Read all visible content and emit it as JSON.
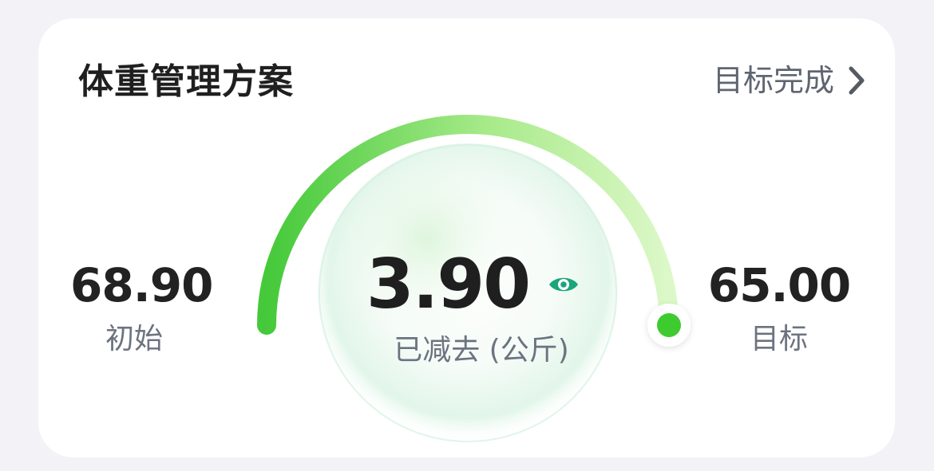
{
  "card": {
    "title": "体重管理方案",
    "link_label": "目标完成"
  },
  "stats": {
    "initial_value": "68.90",
    "initial_label": "初始",
    "lost_value": "3.90",
    "lost_label": "已减去 (公斤)",
    "target_value": "65.00",
    "target_label": "目标"
  },
  "gauge": {
    "progress_fraction": 1.0,
    "color_start": "#45c93a",
    "color_end": "#dcf8c8",
    "knob_color": "#3ecb2f"
  },
  "icons": {
    "link": "chevron-right-icon",
    "visibility": "eye-icon"
  }
}
